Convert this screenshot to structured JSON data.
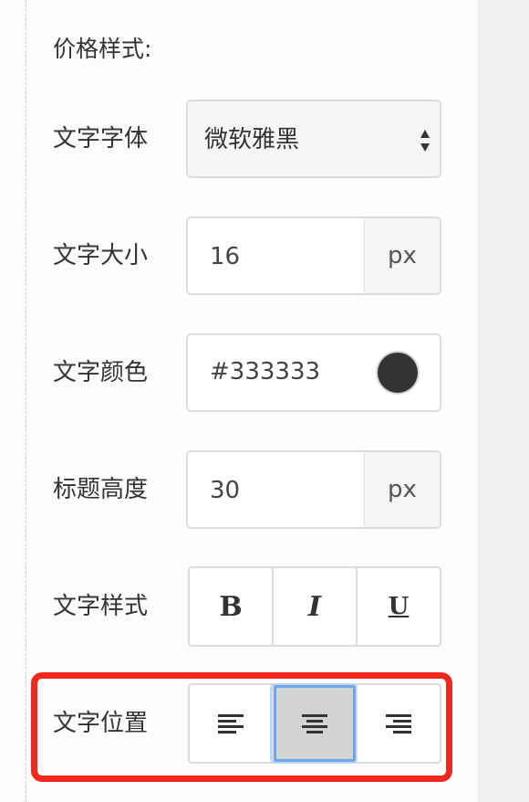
{
  "section": {
    "title": "价格样式:"
  },
  "font_family": {
    "label": "文字字体",
    "value": "微软雅黑"
  },
  "font_size": {
    "label": "文字大小",
    "value": "16",
    "unit": "px"
  },
  "text_color": {
    "label": "文字颜色",
    "value": "#333333",
    "swatch": "#333333"
  },
  "title_height": {
    "label": "标题高度",
    "value": "30",
    "unit": "px"
  },
  "text_style": {
    "label": "文字样式",
    "buttons": [
      "B",
      "I",
      "U"
    ]
  },
  "text_align": {
    "label": "文字位置",
    "options": [
      "align-left-icon",
      "align-center-icon",
      "align-right-icon"
    ],
    "selected": "align-center-icon"
  },
  "colors": {
    "highlight": "#f1281e",
    "active_button": "#d3d3d3",
    "focus_ring": "#6fa4ef"
  }
}
